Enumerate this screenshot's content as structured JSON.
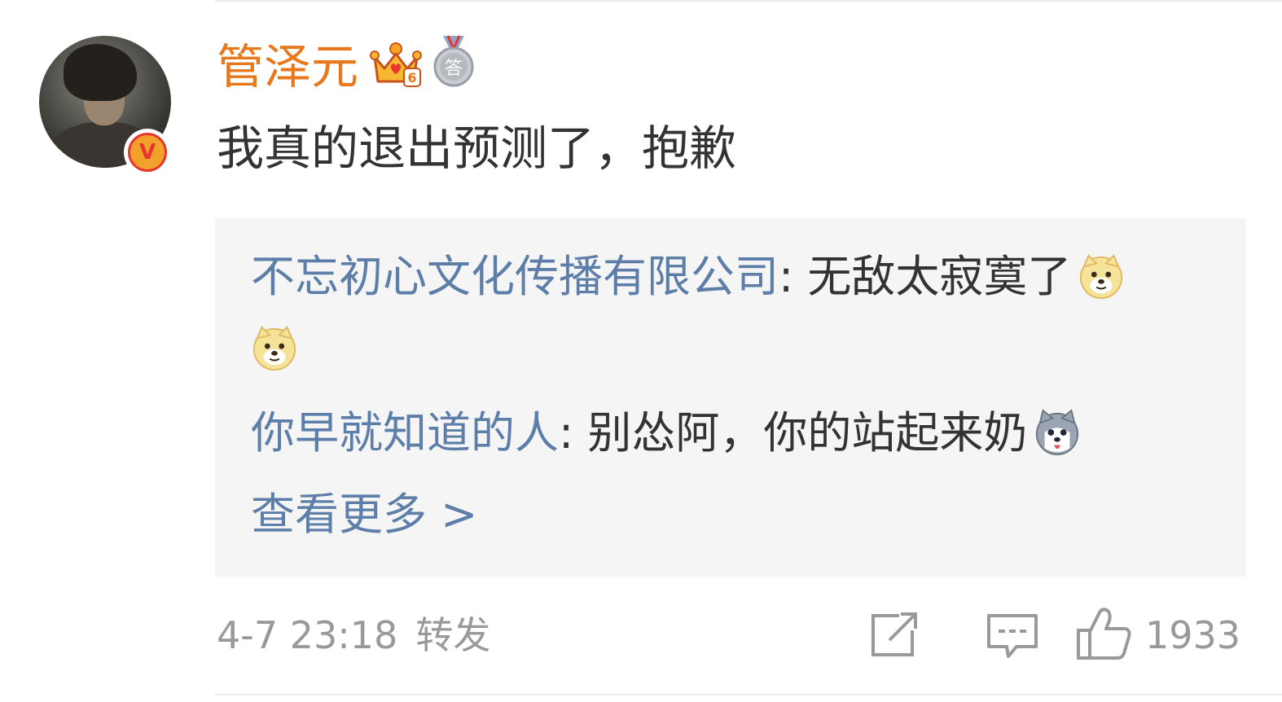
{
  "comment": {
    "username": "管泽元",
    "text": "我真的退出预测了，抱歉",
    "badges": {
      "crown_level": "6",
      "crown_icon": "crown-icon",
      "medal_char": "答",
      "medal_icon": "medal-icon"
    },
    "verified_mark": "V",
    "colors": {
      "username": "#e8781c",
      "link": "#5d7ea8",
      "text": "#333333",
      "meta": "#999999",
      "reply_bg": "#f5f5f5"
    }
  },
  "replies": [
    {
      "author": "不忘初心文化传播有限公司",
      "separator": ": ",
      "text": "无敌太寂寞了",
      "emojis": [
        "doge-emoji",
        "doge-emoji"
      ]
    },
    {
      "author": "你早就知道的人",
      "separator": ": ",
      "text": "别怂阿，你的站起来奶",
      "emojis": [
        "husky-emoji"
      ]
    }
  ],
  "view_more": "查看更多 >",
  "footer": {
    "time": "4-7 23:18",
    "forward": "转发",
    "like_count": "1933"
  }
}
